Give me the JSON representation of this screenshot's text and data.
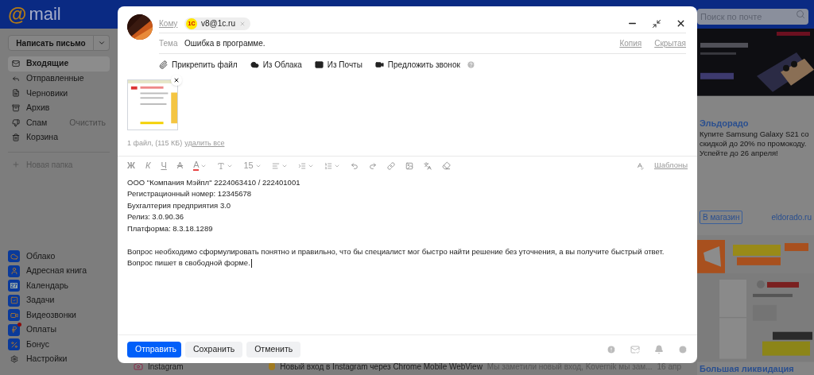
{
  "header": {
    "logo_symbol": "@",
    "logo_text": "mail",
    "search": {
      "placeholder": "Поиск по почте"
    }
  },
  "sidebar": {
    "compose": "Написать письмо",
    "folders": [
      {
        "kind": "inbox",
        "label": "Входящие",
        "selected": true
      },
      {
        "kind": "sent",
        "label": "Отправленные",
        "selected": false
      },
      {
        "kind": "drafts",
        "label": "Черновики",
        "selected": false
      },
      {
        "kind": "archive",
        "label": "Архив",
        "selected": false
      },
      {
        "kind": "spam",
        "label": "Спам",
        "selected": false,
        "action": "Очистить"
      },
      {
        "kind": "trash",
        "label": "Корзина",
        "selected": false
      }
    ],
    "new_folder": "Новая папка",
    "apps": [
      {
        "kind": "cloud",
        "label": "Облако",
        "notification": false
      },
      {
        "kind": "contacts",
        "label": "Адресная книга",
        "notification": false
      },
      {
        "kind": "calendar",
        "label": "Календарь",
        "day": "27",
        "notification": false
      },
      {
        "kind": "tasks",
        "label": "Задачи",
        "notification": false
      },
      {
        "kind": "video",
        "label": "Видеозвонки",
        "notification": false
      },
      {
        "kind": "payments",
        "label": "Оплаты",
        "notification": true
      },
      {
        "kind": "bonus",
        "label": "Бонус",
        "notification": false
      },
      {
        "kind": "settings",
        "label": "Настройки",
        "notification": false
      }
    ]
  },
  "message_row": {
    "sender": "Instagram",
    "subject": "Новый вход в Instagram через Chrome Mobile WebView",
    "snippet": "Мы заметили новый вход, Kovernik мы зам...",
    "date": "16 апр"
  },
  "ads": {
    "title": "Эльдорадо",
    "text": "Купите Samsung Galaxy S21 со скидкой до 20% по промокоду. Успейте до 26 апреля!",
    "button": "В магазин",
    "domain": "eldorado.ru",
    "bottom_title": "Большая ликвидация"
  },
  "compose": {
    "to_label": "Кому",
    "recipient": {
      "logo": "1С",
      "email": "v8@1c.ru"
    },
    "subject_label": "Тема",
    "subject": "Ошибка в программе.",
    "cc": "Копия",
    "bcc": "Скрытая",
    "attach_actions": [
      {
        "kind": "file",
        "label": "Прикрепить файл"
      },
      {
        "kind": "cloud",
        "label": "Из Облака"
      },
      {
        "kind": "mail",
        "label": "Из Почты"
      },
      {
        "kind": "call",
        "label": "Предложить звонок"
      }
    ],
    "attachments_summary": "1 файл, (115 КБ)",
    "delete_all": "удалить все",
    "toolbar": {
      "bold": "Ж",
      "italic": "К",
      "underline": "Ч",
      "strike": "A",
      "text_color_letter": "A",
      "size": "15",
      "templates": "Шаблоны"
    },
    "body": {
      "paragraphs": [
        [
          "ООО \"Компания Мэйпл\" 2224063410 / 222401001",
          "Регистрационный номер: 12345678",
          "Бухгалтерия предприятия 3.0",
          "Релиз: 3.0.90.36",
          "Платформа: 8.3.18.1289"
        ],
        [
          "Вопрос необходимо сформулировать понятно и правильно, что бы специалист мог быстро найти решение без уточнения, а вы получите быстрый ответ.",
          "Вопрос пишет в свободной форме."
        ]
      ],
      "cursor_at_end": true
    },
    "buttons": [
      {
        "kind": "primary",
        "label": "Отправить"
      },
      {
        "kind": "secondary",
        "label": "Сохранить"
      },
      {
        "kind": "secondary",
        "label": "Отменить"
      }
    ]
  }
}
